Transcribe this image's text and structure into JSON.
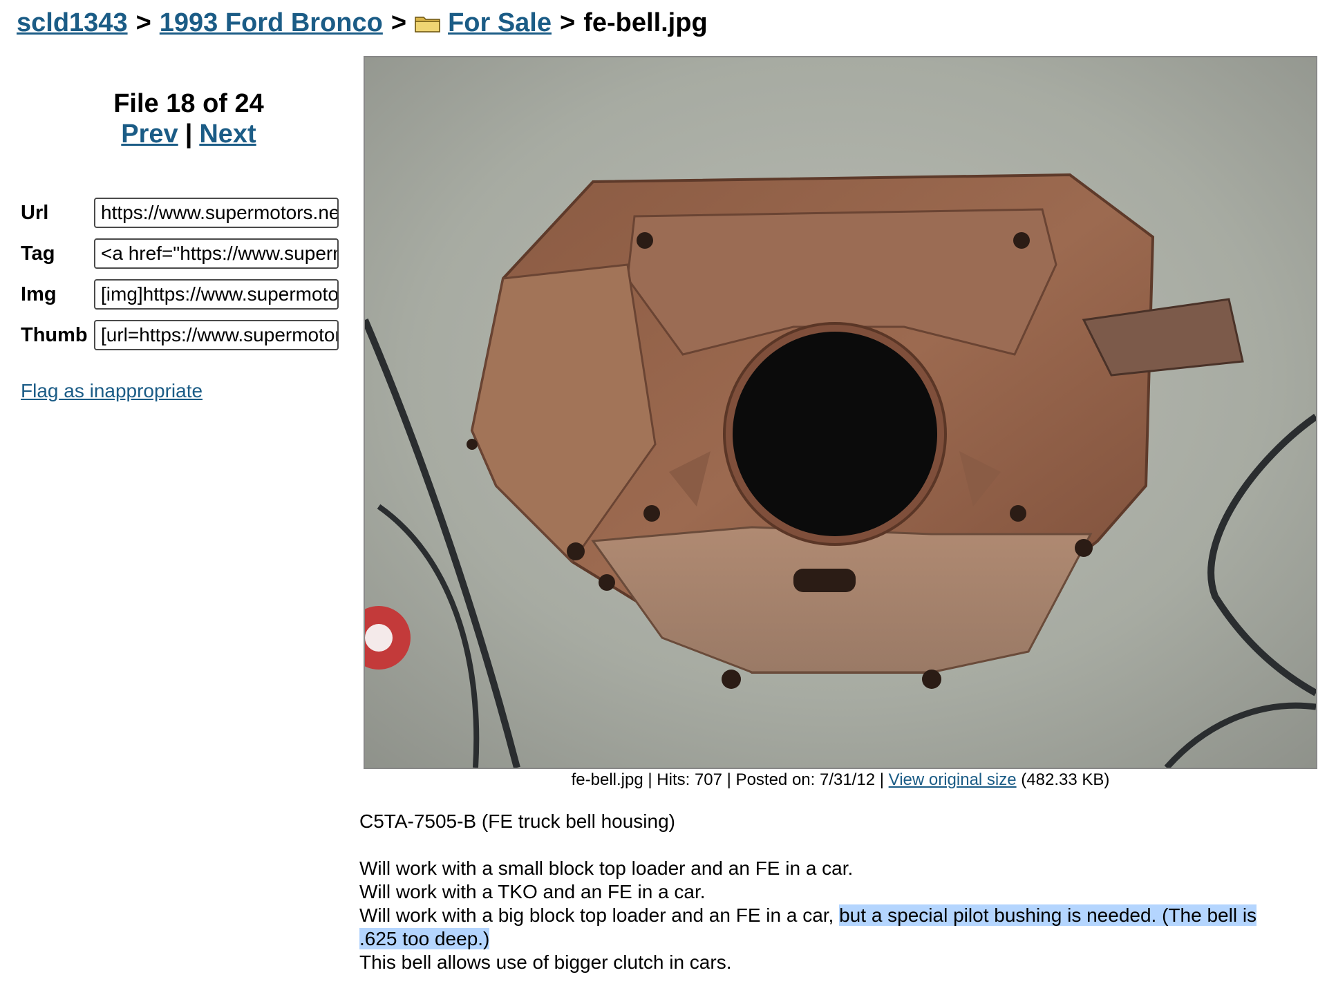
{
  "breadcrumb": {
    "user": "scld1343",
    "album": "1993 Ford Bronco",
    "folder": "For Sale",
    "file": "fe-bell.jpg",
    "separator": ">"
  },
  "nav": {
    "file_count": "File 18 of 24",
    "prev": "Prev",
    "divider": "|",
    "next": "Next"
  },
  "share_fields": [
    {
      "label": "Url",
      "value": "https://www.supermotors.net/getfile/"
    },
    {
      "label": "Tag",
      "value": "<a href=\"https://www.supermotors.net/"
    },
    {
      "label": "Img",
      "value": "[img]https://www.supermotors.net/"
    },
    {
      "label": "Thumb",
      "value": "[url=https://www.supermotors.net/"
    }
  ],
  "flag_link": "Flag as inappropriate",
  "caption": {
    "prefix": "fe-bell.jpg | Hits: 707 | Posted on: 7/31/12 |",
    "view_original": "View original size",
    "size": "(482.33 KB)"
  },
  "description": {
    "title": "C5TA-7505-B (FE truck bell housing)",
    "line1": "Will work with a small block top loader and an FE in a car.",
    "line2": "Will work with a TKO and an FE in a car.",
    "line3_a": "Will work with a big block top loader and an FE in a car,",
    "line3_b": "but a special pilot bushing is needed. (The bell is",
    "line4": ".625 too deep.)",
    "line5": "This bell allows use of bigger clutch in cars."
  },
  "colors": {
    "link": "#1b5c86",
    "selection_highlight": "#b4d5fe"
  },
  "icons": [
    "folder-icon"
  ]
}
